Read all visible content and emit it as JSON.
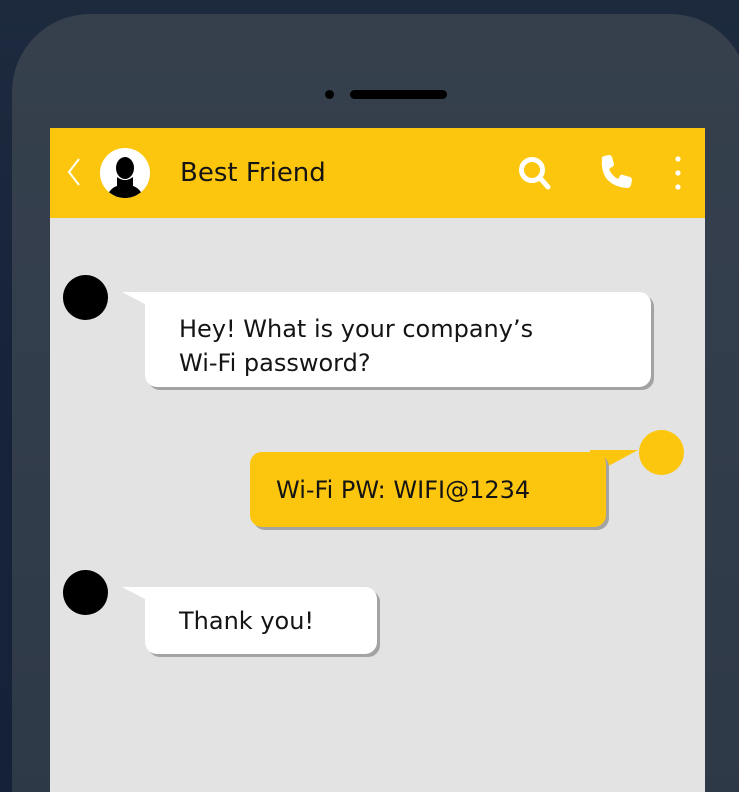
{
  "chat": {
    "contact_name": "Best Friend",
    "messages": [
      {
        "sender": "friend",
        "text_line1": "Hey! What is your company’s",
        "text_line2": "Wi-Fi password?"
      },
      {
        "sender": "me",
        "text": "Wi-Fi PW: WIFI@1234"
      },
      {
        "sender": "friend",
        "text": "Thank you!"
      }
    ]
  },
  "icons": {
    "back": "chevron-left-icon",
    "avatar": "person-silhouette-icon",
    "search": "search-icon",
    "call": "phone-icon",
    "more": "more-vertical-icon"
  },
  "colors": {
    "accent_yellow": "#fdc60e",
    "chat_background": "#e3e3e3",
    "phone_body": "#323d4b",
    "page_background": "#17233a"
  }
}
